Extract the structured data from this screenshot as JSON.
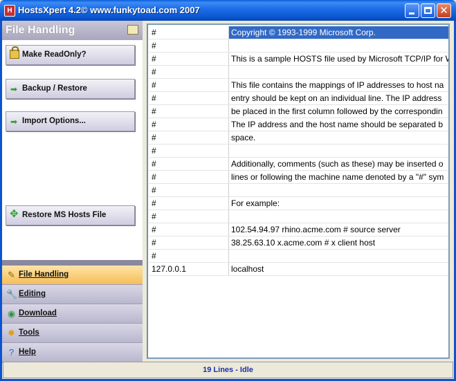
{
  "window": {
    "title": "HostsXpert 4.2© www.funkytoad.com 2007",
    "icon": "app-icon"
  },
  "sidebar": {
    "header_title": "File Handling",
    "actions": [
      {
        "label": "Make ReadOnly?",
        "icon": "lock-icon"
      },
      {
        "label": "Backup / Restore",
        "icon": "arrow-right-icon"
      },
      {
        "label": "Import Options...",
        "icon": "arrow-right-icon"
      },
      {
        "label": "Restore MS Hosts File",
        "icon": "restore-arrows-icon"
      }
    ],
    "nav": [
      {
        "label": "File Handling",
        "icon": "file-handling-icon",
        "active": true
      },
      {
        "label": "Editing",
        "icon": "wrench-icon",
        "active": false
      },
      {
        "label": "Download",
        "icon": "download-globe-icon",
        "active": false
      },
      {
        "label": "Tools",
        "icon": "tools-icon",
        "active": false
      },
      {
        "label": "Help",
        "icon": "help-icon",
        "active": false
      }
    ]
  },
  "hosts": {
    "selected_row": 0,
    "rows": [
      {
        "c1": "#",
        "c2": "Copyright © 1993-1999 Microsoft Corp."
      },
      {
        "c1": "#",
        "c2": ""
      },
      {
        "c1": "#",
        "c2": "This is a sample HOSTS file used by Microsoft TCP/IP for W"
      },
      {
        "c1": "#",
        "c2": ""
      },
      {
        "c1": "#",
        "c2": "This file contains the mappings of IP addresses to host na"
      },
      {
        "c1": "#",
        "c2": "entry should be kept on an individual line. The IP address"
      },
      {
        "c1": "#",
        "c2": "be placed in the first column followed by the correspondin"
      },
      {
        "c1": "#",
        "c2": "The IP address and the host name should be separated b"
      },
      {
        "c1": "#",
        "c2": "space."
      },
      {
        "c1": "#",
        "c2": ""
      },
      {
        "c1": "#",
        "c2": "Additionally, comments (such as these) may be inserted o"
      },
      {
        "c1": "#",
        "c2": "lines or following the machine name denoted by a \"#\" sym"
      },
      {
        "c1": "#",
        "c2": ""
      },
      {
        "c1": "#",
        "c2": "For example:"
      },
      {
        "c1": "#",
        "c2": ""
      },
      {
        "c1": "#",
        "c2": "102.54.94.97 rhino.acme.com # source server"
      },
      {
        "c1": "#",
        "c2": "38.25.63.10 x.acme.com # x client host"
      },
      {
        "c1": "#",
        "c2": ""
      },
      {
        "c1": "127.0.0.1",
        "c2": "localhost"
      }
    ]
  },
  "status": {
    "text": "19 Lines - Idle"
  },
  "colors": {
    "titlebar": "#0b54d0",
    "selection": "#3169c6",
    "status_text": "#1a2fb0",
    "active_nav": "#f6be5a"
  }
}
